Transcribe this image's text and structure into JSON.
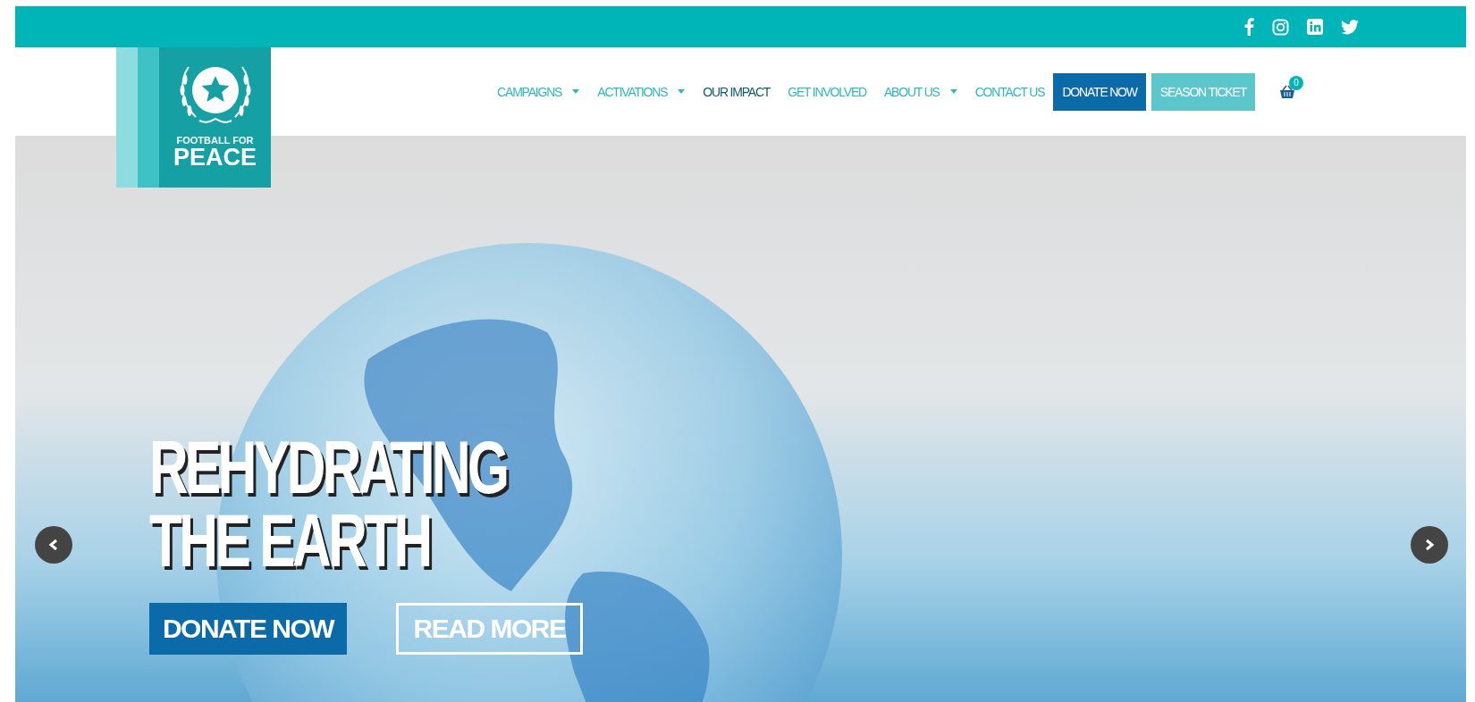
{
  "logo": {
    "line_1": "FOOTBALL FOR",
    "line_2": "PEACE"
  },
  "nav": {
    "items": [
      {
        "label": "CAMPAIGNS",
        "selected": false,
        "dropdown": true
      },
      {
        "label": "ACTIVATIONS",
        "selected": false,
        "dropdown": true
      },
      {
        "label": "OUR IMPACT",
        "selected": true,
        "dropdown": false
      },
      {
        "label": "GET INVOLVED",
        "selected": false,
        "dropdown": false
      },
      {
        "label": "ABOUT US",
        "selected": false,
        "dropdown": true
      },
      {
        "label": "CONTACT US",
        "selected": false,
        "dropdown": false
      }
    ],
    "buttons": [
      {
        "label": "DONATE NOW",
        "kind": "primary"
      },
      {
        "label": "SEASON TICKET",
        "kind": "secondary"
      }
    ],
    "cart": {
      "count": "0"
    }
  },
  "hero": {
    "title_lines": [
      "REHYDRATING",
      "THE EARTH"
    ],
    "buttons": [
      {
        "label": "DONATE NOW",
        "kind": "filled"
      },
      {
        "label": "READ MORE",
        "kind": "outline"
      }
    ]
  }
}
